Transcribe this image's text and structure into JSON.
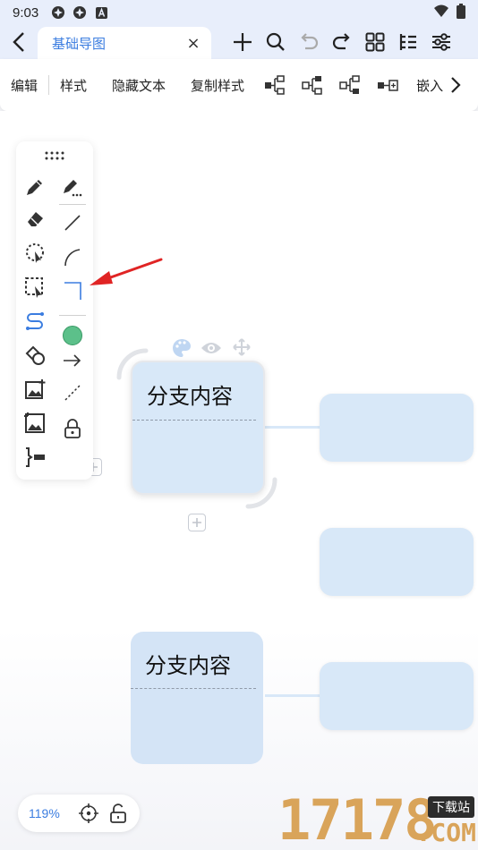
{
  "status_bar": {
    "time": "9:03",
    "icons": [
      "app-notification-icon",
      "app-notification-icon",
      "letter-a-icon"
    ],
    "right_icons": [
      "wifi-icon",
      "battery-icon"
    ]
  },
  "title_bar": {
    "tab_title": "基础导图",
    "close_glyph": "×",
    "actions": [
      "add-icon",
      "search-icon",
      "undo-icon",
      "redo-icon",
      "grid-icon",
      "outline-icon",
      "settings-sliders-icon"
    ]
  },
  "toolbar": {
    "edit": "编辑",
    "style": "样式",
    "hide_text": "隐藏文本",
    "copy_style": "复制样式",
    "embed": "嵌入",
    "layout_icons": [
      "add-child-node-icon",
      "add-sibling-node-icon",
      "add-parent-node-icon",
      "add-free-node-icon"
    ]
  },
  "palette": {
    "handle": "drag-handle-icon",
    "left_column": [
      "pen-icon",
      "eraser-icon",
      "lasso-select-icon",
      "box-select-icon",
      "connect-line-icon",
      "shape-icon",
      "image-add-icon",
      "image-icon",
      "bracket-icon"
    ],
    "right_column": [
      "marker-pen-icon",
      "straight-line-icon",
      "arc-line-icon",
      "elbow-line-icon",
      "color-swatch-icon",
      "arrow-icon",
      "dotted-line-icon",
      "lock-icon"
    ],
    "colors": {
      "accent": "#3b7de0",
      "swatch": "#5cc08a",
      "annotation_arrow": "#e02424"
    }
  },
  "mindmap": {
    "nodes": [
      {
        "text": "分支内容",
        "selected": true
      },
      {
        "text": "分支内容",
        "selected": false
      },
      {
        "text": ""
      },
      {
        "text": ""
      },
      {
        "text": ""
      }
    ],
    "node_toolbar": [
      "palette-icon",
      "eye-icon",
      "move-icon"
    ],
    "colors": {
      "node_fill": "#d8e8f8",
      "dash": "#8f9aa8"
    }
  },
  "zoom": {
    "level": "119%"
  },
  "watermark": {
    "digits": "17178",
    "badge": "下载站",
    "suffix": ".COM"
  }
}
